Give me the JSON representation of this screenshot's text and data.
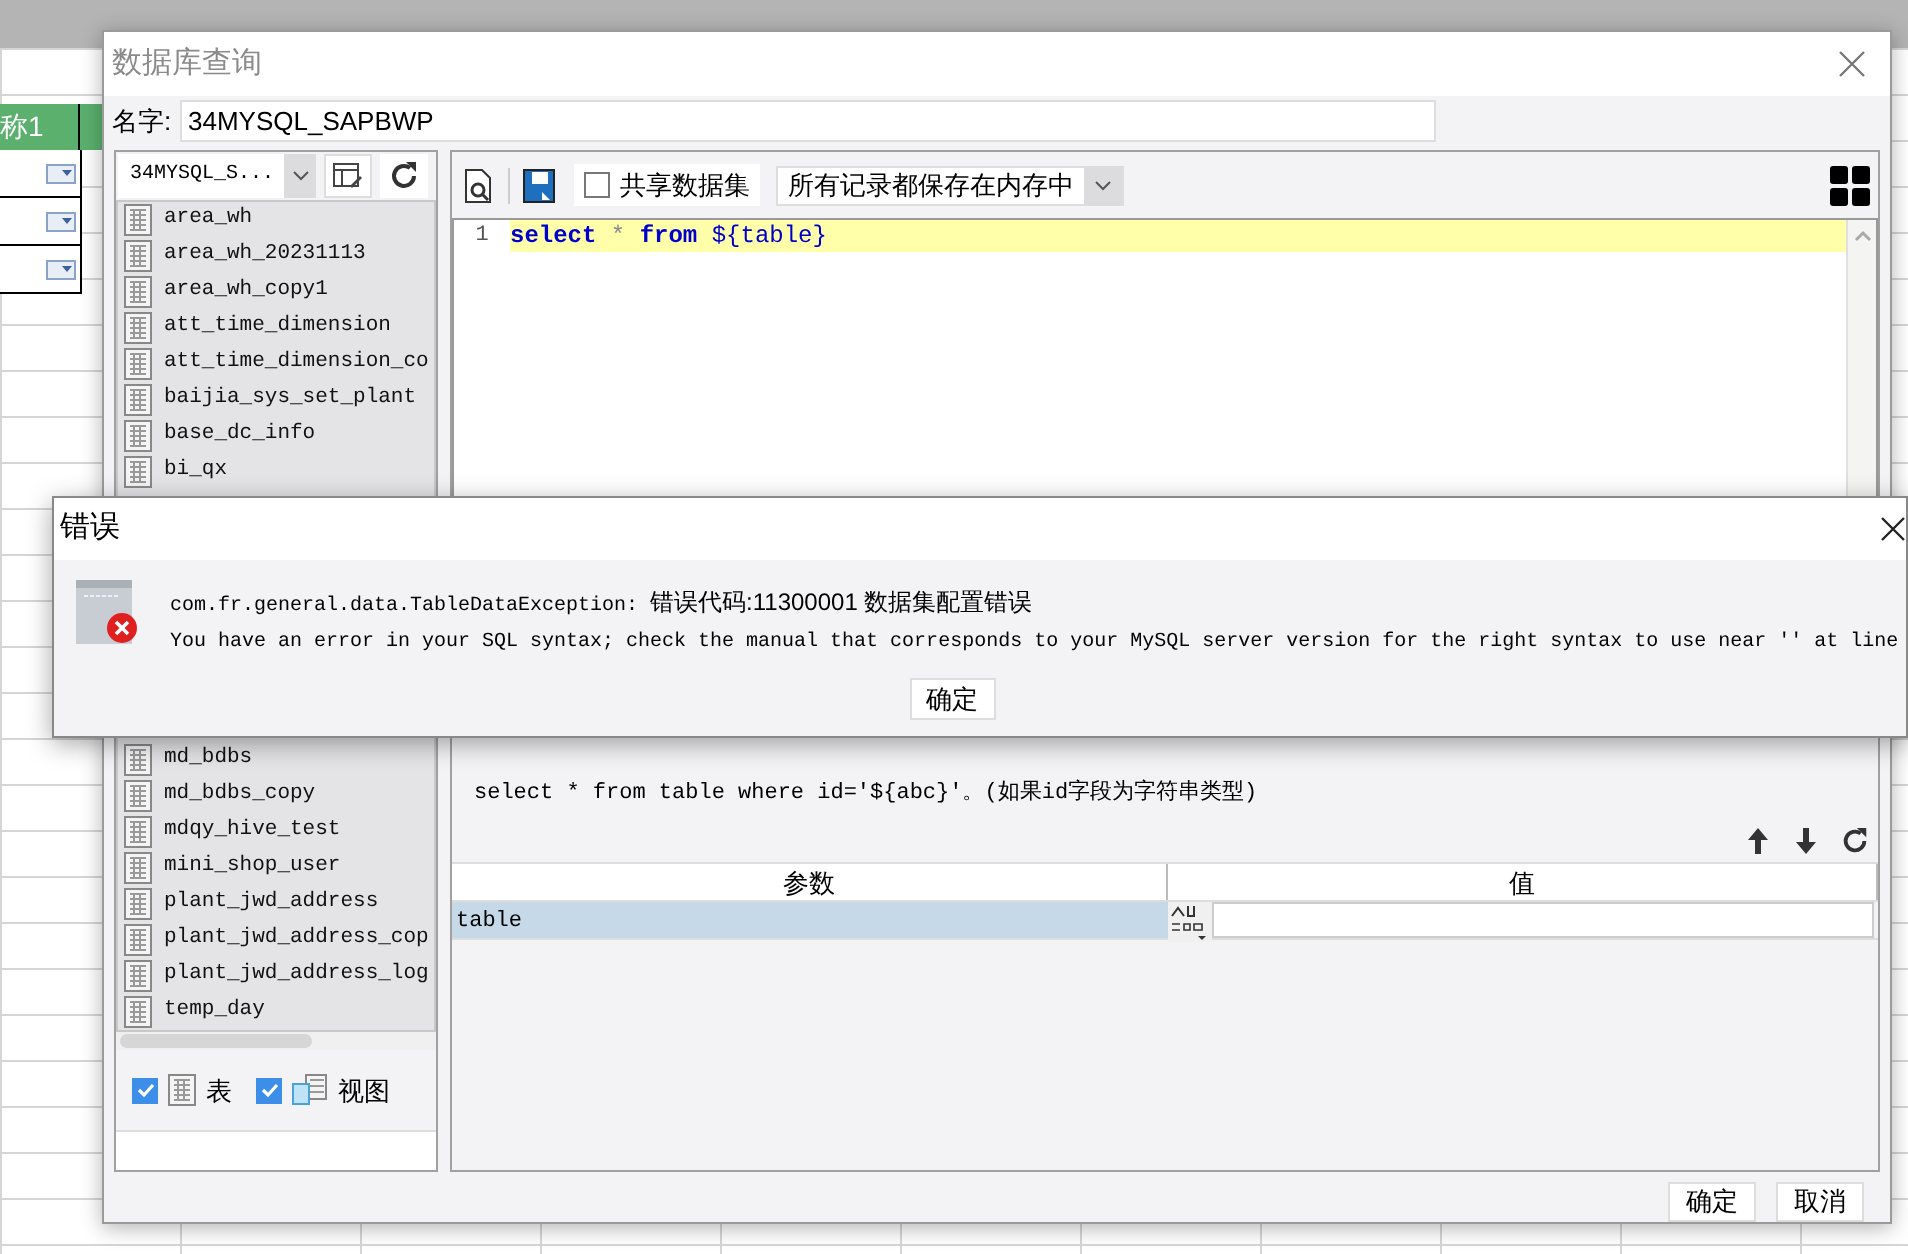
{
  "sheet": {
    "headers": [
      "称1"
    ]
  },
  "dialog": {
    "title": "数据库查询",
    "name_label": "名字:",
    "name_value": "34MYSQL_SAPBWP",
    "connection": "34MYSQL_S...",
    "tables_top": [
      "area_wh",
      "area_wh_20231113",
      "area_wh_copy1",
      "att_time_dimension",
      "att_time_dimension_co",
      "baijia_sys_set_plant",
      "base_dc_info",
      "bi_qx"
    ],
    "tables_bottom": [
      "md_bdbs",
      "md_bdbs_copy",
      "mdqy_hive_test",
      "mini_shop_user",
      "plant_jwd_address",
      "plant_jwd_address_cop",
      "plant_jwd_address_log",
      "temp_day"
    ],
    "filters": [
      {
        "label": "表",
        "checked": true,
        "kind": "table"
      },
      {
        "label": "视图",
        "checked": true,
        "kind": "view"
      }
    ],
    "share_checkbox": {
      "label": "共享数据集",
      "checked": false
    },
    "storage_select": "所有记录都保存在内存中",
    "editor": {
      "lines": [
        {
          "number": "1",
          "highlighted": true,
          "tokens": [
            {
              "text": "select",
              "kind": "keyword"
            },
            {
              "text": " * ",
              "kind": "operator"
            },
            {
              "text": "from",
              "kind": "keyword"
            },
            {
              "text": " ${table}",
              "kind": "variable"
            }
          ]
        }
      ]
    },
    "hint_lines": [
      "select * from table where id='${abc}'。(如果id字段为字符串类型)"
    ],
    "params": {
      "columns": [
        "参数",
        "值"
      ],
      "rows": [
        {
          "name": "table",
          "selected": true
        }
      ]
    },
    "buttons": [
      "确定",
      "取消"
    ]
  },
  "error_dialog": {
    "title": "错误",
    "exception": "com.fr.general.data.TableDataException:",
    "message": "错误代码:11300001 数据集配置错误",
    "detail": "You have an error in your SQL syntax; check the manual that corresponds to your MySQL server version for the right syntax to use near '' at line",
    "button": "确定"
  }
}
